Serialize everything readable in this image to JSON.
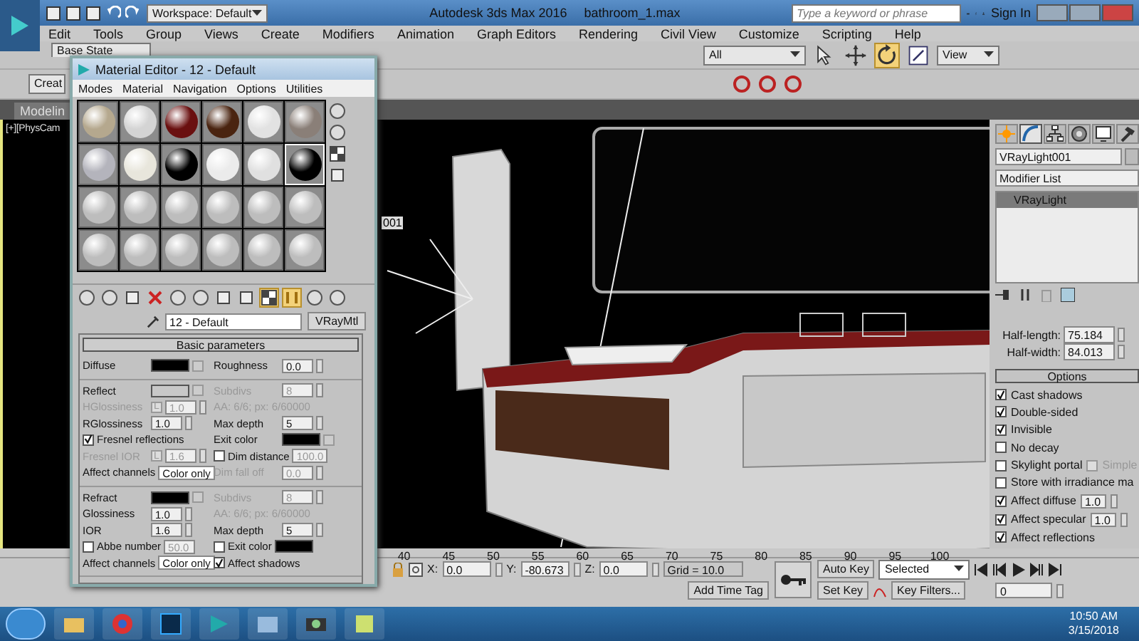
{
  "app": {
    "title": "Autodesk 3ds Max 2016",
    "file": "bathroom_1.max",
    "workspace": "Workspace: Default",
    "search_placeholder": "Type a keyword or phrase",
    "sign_in": "Sign In"
  },
  "menu": [
    "Edit",
    "Tools",
    "Group",
    "Views",
    "Create",
    "Modifiers",
    "Animation",
    "Graph Editors",
    "Rendering",
    "Civil View",
    "Customize",
    "Scripting",
    "Help"
  ],
  "main_toolbar": {
    "state_set": "Base State",
    "selection_filter": "All",
    "reference_system": "View",
    "tools": [
      {
        "kind": "select",
        "active": false
      },
      {
        "kind": "move",
        "active": false
      },
      {
        "kind": "rotate",
        "active": true
      },
      {
        "kind": "scale",
        "active": false
      }
    ]
  },
  "ribbon": {
    "create_field": "Creat",
    "tab": "Modelin"
  },
  "viewport": {
    "label": "[+][PhysCam",
    "object_tag": "001"
  },
  "material_editor": {
    "title": "Material Editor - 12 - Default",
    "menu": [
      "Modes",
      "Material",
      "Navigation",
      "Options",
      "Utilities"
    ],
    "slots": [
      {
        "color": "#b5a88e",
        "selected": false
      },
      {
        "color": "#d4d4d4",
        "selected": false
      },
      {
        "color": "#6a1010",
        "selected": false
      },
      {
        "color": "#4a2410",
        "selected": false
      },
      {
        "color": "#e2e2e2",
        "selected": false
      },
      {
        "color": "#8a7f78",
        "selected": false
      },
      {
        "color": "#b4b4bc",
        "selected": false
      },
      {
        "color": "#e8e6dc",
        "selected": false
      },
      {
        "color": "#000000",
        "selected": false
      },
      {
        "color": "#ebebeb",
        "selected": false
      },
      {
        "color": "#e0e0e0",
        "selected": false
      },
      {
        "color": "#000000",
        "selected": true
      },
      {
        "color": "#bdbdbd",
        "selected": false
      },
      {
        "color": "#bdbdbd",
        "selected": false
      },
      {
        "color": "#bdbdbd",
        "selected": false
      },
      {
        "color": "#bdbdbd",
        "selected": false
      },
      {
        "color": "#bdbdbd",
        "selected": false
      },
      {
        "color": "#bdbdbd",
        "selected": false
      },
      {
        "color": "#bdbdbd",
        "selected": false
      },
      {
        "color": "#bdbdbd",
        "selected": false
      },
      {
        "color": "#bdbdbd",
        "selected": false
      },
      {
        "color": "#bdbdbd",
        "selected": false
      },
      {
        "color": "#bdbdbd",
        "selected": false
      },
      {
        "color": "#bdbdbd",
        "selected": false
      }
    ],
    "tools": [
      {
        "kind": "sphere",
        "active": false
      },
      {
        "kind": "sphere",
        "active": false
      },
      {
        "kind": "box",
        "active": false
      },
      {
        "kind": "cross",
        "active": false
      },
      {
        "kind": "sphere",
        "active": false
      },
      {
        "kind": "sphere",
        "active": false
      },
      {
        "kind": "box",
        "active": false
      },
      {
        "kind": "box",
        "active": false
      },
      {
        "kind": "checker",
        "active": true
      },
      {
        "kind": "bars",
        "active": true
      },
      {
        "kind": "sphere",
        "active": false
      },
      {
        "kind": "sphere",
        "active": false
      }
    ],
    "material_name": "12 - Default",
    "material_type": "VRayMtl",
    "rollout": "Basic parameters",
    "groups": [
      [
        {
          "left": {
            "kind": "color",
            "label": "Diffuse",
            "color": "#000000",
            "disabled": false
          },
          "right": {
            "kind": "spinner",
            "label": "Roughness",
            "value": "0.0",
            "disabled": false
          }
        }
      ],
      [
        {
          "left": {
            "kind": "color",
            "label": "Reflect",
            "color": "#c8c8c8",
            "disabled": false
          },
          "right": {
            "kind": "spinner",
            "label": "Subdivs",
            "value": "8",
            "disabled": true
          }
        },
        {
          "left": {
            "kind": "spinner",
            "label": "HGlossiness",
            "lock": "L",
            "value": "1.0",
            "disabled": true
          },
          "right": {
            "kind": "info",
            "label": "AA: 6/6; px: 6/60000",
            "disabled": true
          }
        },
        {
          "left": {
            "kind": "spinner",
            "label": "RGlossiness",
            "value": "1.0",
            "disabled": false
          },
          "right": {
            "kind": "spinner",
            "label": "Max depth",
            "value": "5",
            "disabled": false
          }
        },
        {
          "left": {
            "kind": "check",
            "label": "Fresnel reflections",
            "checked": true,
            "disabled": false
          },
          "right": {
            "kind": "color",
            "label": "Exit color",
            "color": "#000000",
            "disabled": false
          }
        },
        {
          "left": {
            "kind": "spinner",
            "label": "Fresnel IOR",
            "lock": "L",
            "value": "1.6",
            "disabled": true
          },
          "right": {
            "kind": "check",
            "label": "Dim distance",
            "checked": false,
            "value": "100.0",
            "disabled": true
          }
        },
        {
          "left": {
            "kind": "dropdown",
            "label": "Affect channels",
            "value": "Color only",
            "disabled": false
          },
          "right": {
            "kind": "spinner",
            "label": "Dim fall off",
            "value": "0.0",
            "disabled": true
          }
        }
      ],
      [
        {
          "left": {
            "kind": "color",
            "label": "Refract",
            "color": "#000000",
            "disabled": false
          },
          "right": {
            "kind": "spinner",
            "label": "Subdivs",
            "value": "8",
            "disabled": true
          }
        },
        {
          "left": {
            "kind": "spinner",
            "label": "Glossiness",
            "value": "1.0",
            "disabled": false
          },
          "right": {
            "kind": "info",
            "label": "AA: 6/6; px: 6/60000",
            "disabled": true
          }
        },
        {
          "left": {
            "kind": "spinner",
            "label": "IOR",
            "value": "1.6",
            "disabled": false
          },
          "right": {
            "kind": "spinner",
            "label": "Max depth",
            "value": "5",
            "disabled": false
          }
        },
        {
          "left": {
            "kind": "check",
            "label": "Abbe number",
            "checked": false,
            "value": "50.0",
            "disabled": true
          },
          "right": {
            "kind": "check",
            "label": "Exit color",
            "checked": false,
            "color": "#000000",
            "disabled": false
          }
        },
        {
          "left": {
            "kind": "dropdown",
            "label": "Affect channels",
            "value": "Color only",
            "disabled": false
          },
          "right": {
            "kind": "check",
            "label": "Affect shadows",
            "checked": true,
            "disabled": false
          }
        }
      ]
    ]
  },
  "command_panel": {
    "tabs": [
      {
        "kind": "create",
        "selected": false
      },
      {
        "kind": "modify",
        "selected": true
      },
      {
        "kind": "hierarchy",
        "selected": false
      },
      {
        "kind": "motion",
        "selected": false
      },
      {
        "kind": "display",
        "selected": false
      },
      {
        "kind": "utilities",
        "selected": false
      }
    ],
    "object_name": "VRayLight001",
    "modifier_list": "Modifier List",
    "stack": [
      {
        "label": "VRayLight",
        "selected": true
      }
    ],
    "size": [
      {
        "label": "Half-length:",
        "value": "75.184"
      },
      {
        "label": "Half-width:",
        "value": "84.013"
      }
    ],
    "options_title": "Options",
    "options": [
      {
        "label": "Cast shadows",
        "checked": true,
        "disabled": false
      },
      {
        "label": "Double-sided",
        "checked": true,
        "disabled": false
      },
      {
        "label": "Invisible",
        "checked": true,
        "disabled": false
      },
      {
        "label": "No decay",
        "checked": false,
        "disabled": false
      },
      {
        "label": "Skylight portal",
        "checked": false,
        "disabled": false,
        "extra": {
          "label": "Simple",
          "checked": false,
          "disabled": true
        }
      },
      {
        "label": "Store with irradiance ma",
        "checked": false,
        "disabled": false
      },
      {
        "label": "Affect diffuse",
        "checked": true,
        "disabled": false,
        "value": "1.0"
      },
      {
        "label": "Affect specular",
        "checked": true,
        "disabled": false,
        "value": "1.0"
      },
      {
        "label": "Affect reflections",
        "checked": true,
        "disabled": false
      }
    ]
  },
  "timeline": {
    "ticks": [
      "40",
      "45",
      "50",
      "55",
      "60",
      "65",
      "70",
      "75",
      "80",
      "85",
      "90",
      "95",
      "100"
    ]
  },
  "status": {
    "coords": [
      {
        "label": "X:",
        "value": "0.0"
      },
      {
        "label": "Y:",
        "value": "-80.673"
      },
      {
        "label": "Z:",
        "value": "0.0"
      }
    ],
    "grid": "Grid = 10.0",
    "time_tag": "Add Time Tag",
    "auto_key": "Auto Key",
    "set_key": "Set Key",
    "key_mode": "Selected",
    "key_filters": "Key Filters...",
    "frame": "0"
  },
  "taskbar": {
    "time": "10:50 AM",
    "date": "3/15/2018"
  }
}
